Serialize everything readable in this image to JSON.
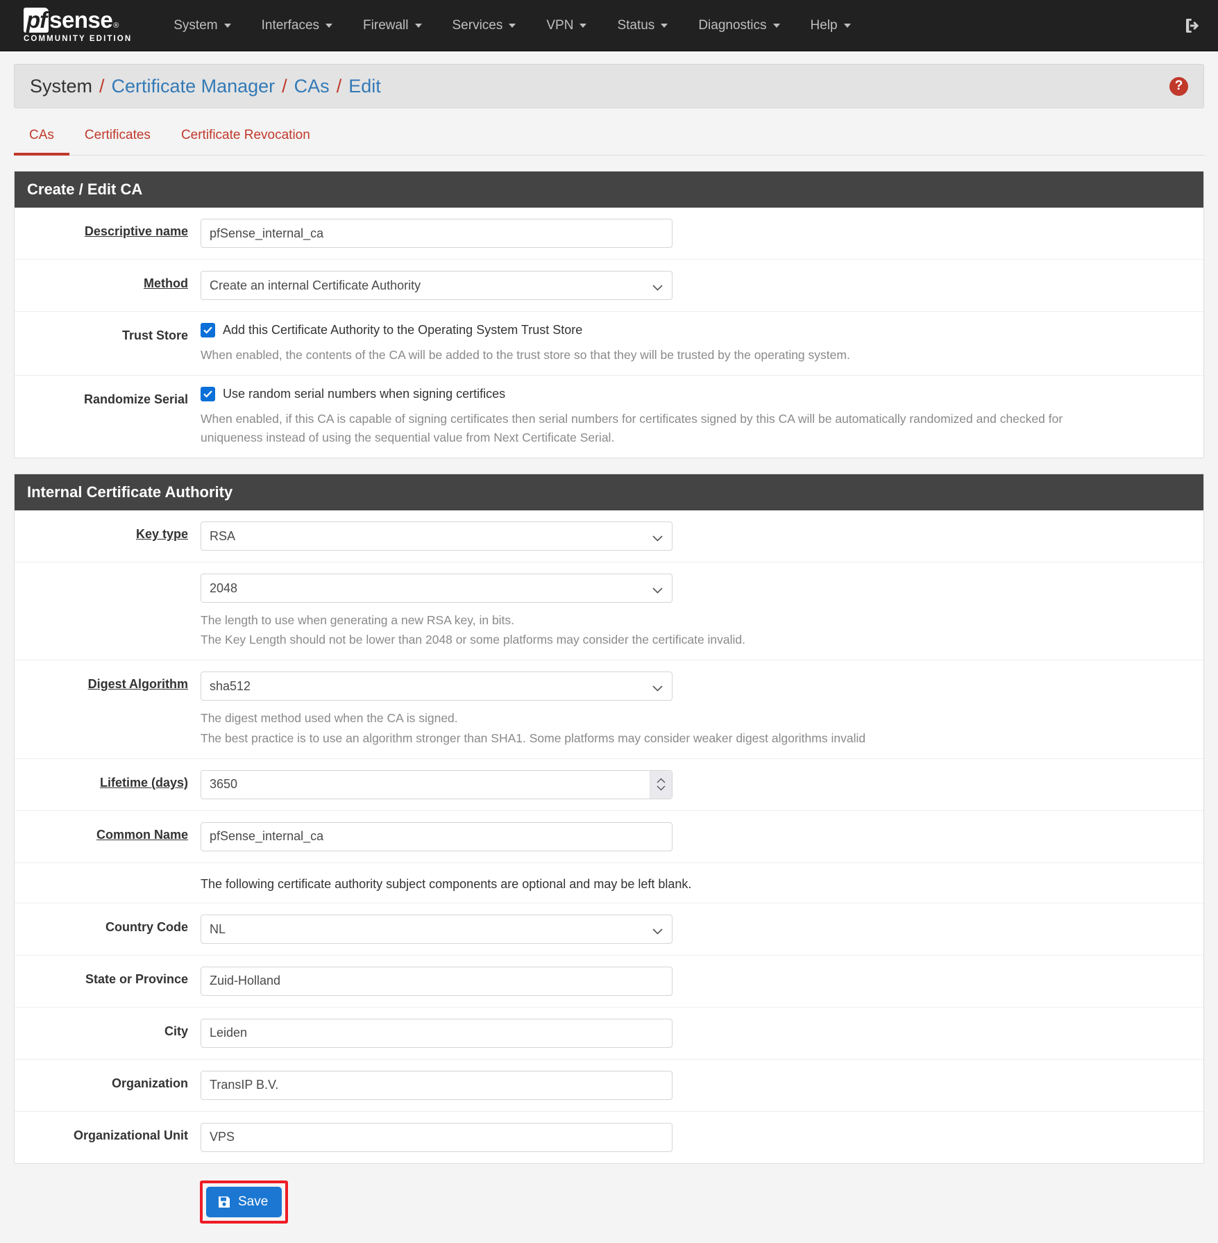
{
  "navbar": {
    "brand": {
      "pf": "pf",
      "sense": "sense",
      "edition": "COMMUNITY EDITION"
    },
    "items": [
      {
        "label": "System"
      },
      {
        "label": "Interfaces"
      },
      {
        "label": "Firewall"
      },
      {
        "label": "Services"
      },
      {
        "label": "VPN"
      },
      {
        "label": "Status"
      },
      {
        "label": "Diagnostics"
      },
      {
        "label": "Help"
      }
    ],
    "logout_icon": "sign-out-icon"
  },
  "breadcrumb": {
    "root": "System",
    "sep": "/",
    "links": [
      "Certificate Manager",
      "CAs",
      "Edit"
    ],
    "help_icon": "?"
  },
  "tabs": [
    {
      "label": "CAs",
      "active": true
    },
    {
      "label": "Certificates",
      "active": false
    },
    {
      "label": "Certificate Revocation",
      "active": false
    }
  ],
  "create_edit_ca": {
    "heading": "Create / Edit CA",
    "descriptive_name": {
      "label": "Descriptive name",
      "value": "pfSense_internal_ca"
    },
    "method": {
      "label": "Method",
      "value": "Create an internal Certificate Authority"
    },
    "trust_store": {
      "label": "Trust Store",
      "checkbox_label": "Add this Certificate Authority to the Operating System Trust Store",
      "help": "When enabled, the contents of the CA will be added to the trust store so that they will be trusted by the operating system."
    },
    "randomize_serial": {
      "label": "Randomize Serial",
      "checkbox_label": "Use random serial numbers when signing certifices",
      "help": "When enabled, if this CA is capable of signing certificates then serial numbers for certificates signed by this CA will be automatically randomized and checked for uniqueness instead of using the sequential value from Next Certificate Serial."
    }
  },
  "internal_ca": {
    "heading": "Internal Certificate Authority",
    "key_type": {
      "label": "Key type",
      "value": "RSA"
    },
    "key_length": {
      "value": "2048",
      "help_line1": "The length to use when generating a new RSA key, in bits.",
      "help_line2": "The Key Length should not be lower than 2048 or some platforms may consider the certificate invalid."
    },
    "digest_algorithm": {
      "label": "Digest Algorithm",
      "value": "sha512",
      "help_line1": "The digest method used when the CA is signed.",
      "help_line2": "The best practice is to use an algorithm stronger than SHA1. Some platforms may consider weaker digest algorithms invalid"
    },
    "lifetime": {
      "label": "Lifetime (days)",
      "value": "3650"
    },
    "common_name": {
      "label": "Common Name",
      "value": "pfSense_internal_ca"
    },
    "optional_note": "The following certificate authority subject components are optional and may be left blank.",
    "country_code": {
      "label": "Country Code",
      "value": "NL"
    },
    "state": {
      "label": "State or Province",
      "value": "Zuid-Holland"
    },
    "city": {
      "label": "City",
      "value": "Leiden"
    },
    "organization": {
      "label": "Organization",
      "value": "TransIP B.V."
    },
    "organizational_unit": {
      "label": "Organizational Unit",
      "value": "VPS"
    }
  },
  "actions": {
    "save_label": "Save"
  },
  "colors": {
    "navbar_bg": "#212121",
    "accent_red": "#c0392b",
    "link_blue": "#337ab7",
    "panel_heading": "#444444",
    "checkbox_blue": "#0b6fd8",
    "save_blue": "#1b77d2",
    "highlight_red": "#ee1c25"
  }
}
